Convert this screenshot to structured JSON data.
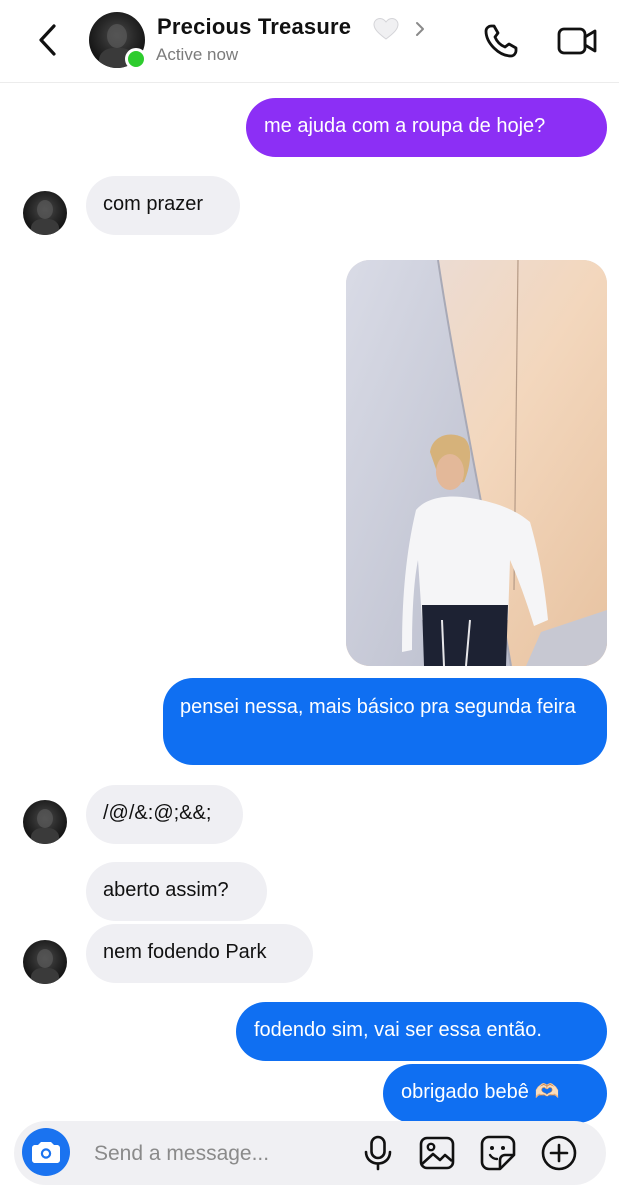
{
  "header": {
    "contact_name": "Precious Treasure",
    "status": "Active now",
    "icons": [
      "back-chevron-icon",
      "white-heart-icon",
      "chevron-right-icon",
      "phone-icon",
      "video-camera-icon"
    ]
  },
  "messages": [
    {
      "from": "me",
      "text": "me ajuda com a roupa de hoje?",
      "color": "#8c2ff5"
    },
    {
      "from": "them",
      "text": "com prazer"
    },
    {
      "from": "me",
      "type": "photo",
      "description_icon": "photo-message"
    },
    {
      "from": "me",
      "text": "pensei nessa, mais básico pra segunda feira",
      "color": "#0f6ff2"
    },
    {
      "from": "them",
      "text": "/@/&:@;&&;"
    },
    {
      "from": "them",
      "text": "aberto assim?"
    },
    {
      "from": "them",
      "text": "nem fodendo Park"
    },
    {
      "from": "me",
      "text": "fodendo sim, vai ser essa então.",
      "color": "#0f6ff2"
    },
    {
      "from": "me",
      "text": "obrigado bebê 🫶🏻",
      "color": "#0f6ff2"
    }
  ],
  "composer": {
    "placeholder": "Send a message...",
    "icons": [
      "camera-icon",
      "microphone-icon",
      "image-icon",
      "sticker-icon",
      "plus-circle-icon"
    ]
  },
  "colors": {
    "outgoing_purple": "#8c2ff5",
    "outgoing_blue": "#0f6ff2",
    "incoming_gray": "#efeff3",
    "online": "#2ecc2e"
  }
}
